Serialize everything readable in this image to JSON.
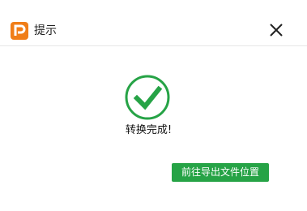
{
  "dialog": {
    "title": "提示",
    "message": "转换完成!",
    "primary_button": "前往导出文件位置"
  },
  "icons": {
    "app_logo": "app-logo-icon",
    "close": "close-icon",
    "success": "check-circle-icon"
  },
  "colors": {
    "accent_green": "#26a346",
    "logo_orange": "#f07e18"
  }
}
